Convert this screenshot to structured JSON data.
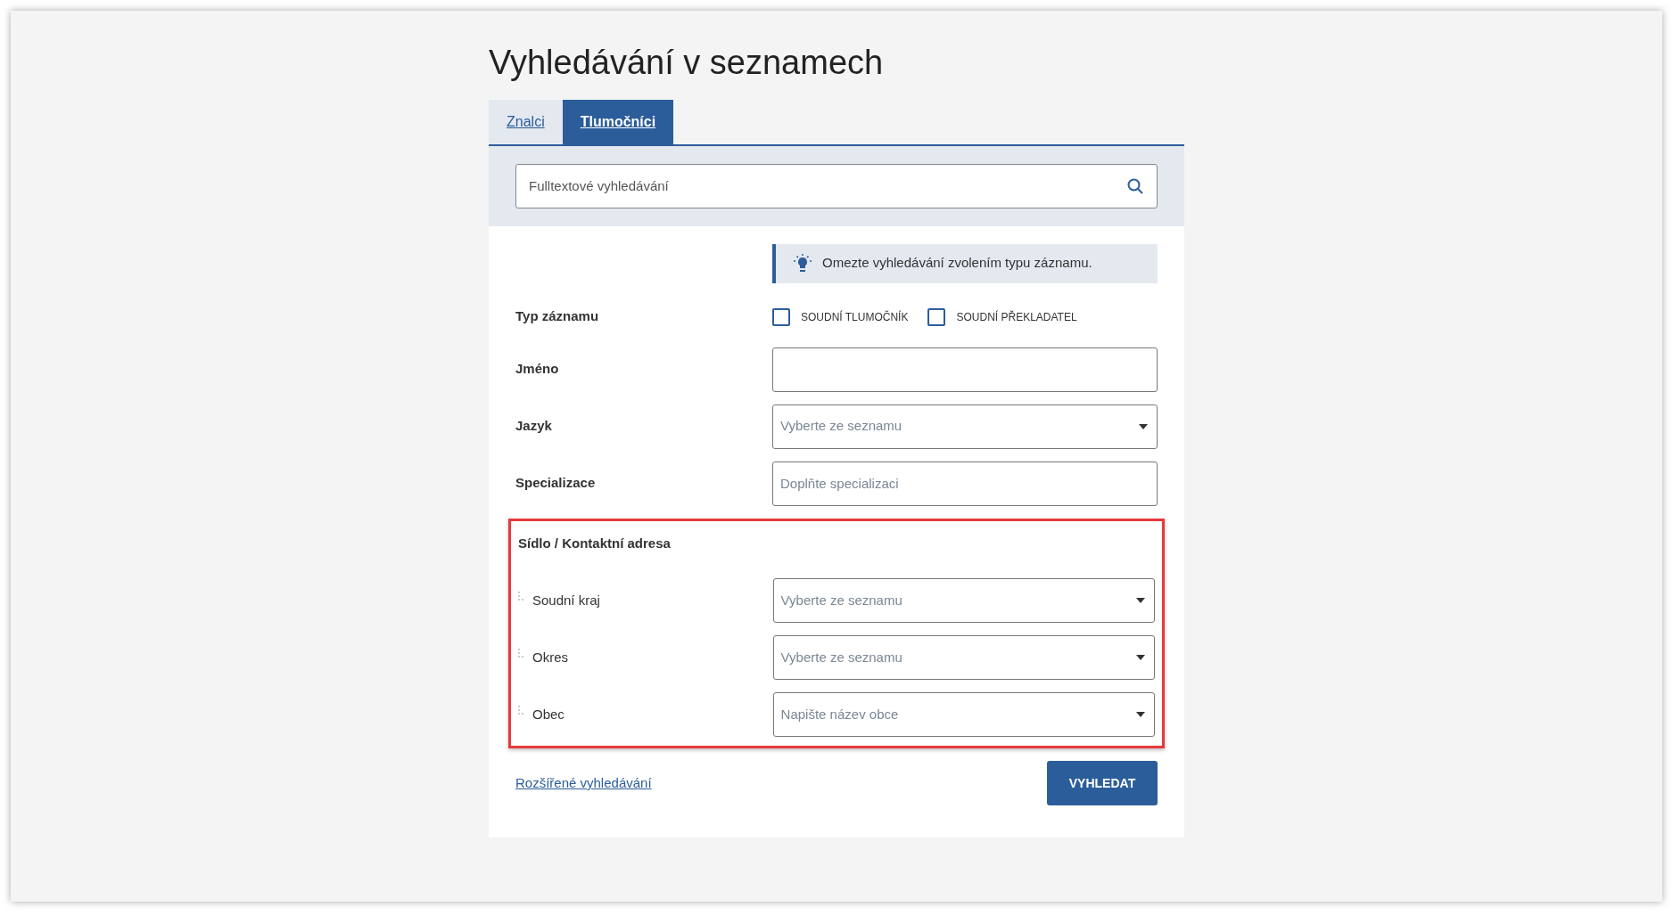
{
  "title": "Vyhledávání v seznamech",
  "tabs": [
    {
      "label": "Znalci",
      "selected": false
    },
    {
      "label": "Tlumočníci",
      "selected": true
    }
  ],
  "search": {
    "placeholder": "Fulltextové vyhledávání"
  },
  "hint": "Omezte vyhledávání zvolením typu záznamu.",
  "record_type": {
    "label": "Typ záznamu",
    "options": [
      {
        "label": "SOUDNÍ TLUMOČNÍK",
        "checked": false
      },
      {
        "label": "SOUDNÍ PŘEKLADATEL",
        "checked": false
      }
    ]
  },
  "fields": [
    {
      "label": "Jméno",
      "kind": "text"
    },
    {
      "label": "Jazyk",
      "kind": "select",
      "placeholder": "Vyberte ze seznamu"
    },
    {
      "label": "Specializace",
      "kind": "text",
      "placeholder": "Doplňte specializaci"
    }
  ],
  "address": {
    "heading": "Sídlo / Kontaktní adresa",
    "highlighted": true,
    "fields": [
      {
        "label": "Soudní kraj",
        "kind": "select",
        "placeholder": "Vyberte ze seznamu"
      },
      {
        "label": "Okres",
        "kind": "select",
        "placeholder": "Vyberte ze seznamu"
      },
      {
        "label": "Obec",
        "kind": "select",
        "placeholder": "Napište název obce"
      }
    ]
  },
  "advanced_link": "Rozšířené vyhledávání",
  "submit": "VYHLEDAT"
}
